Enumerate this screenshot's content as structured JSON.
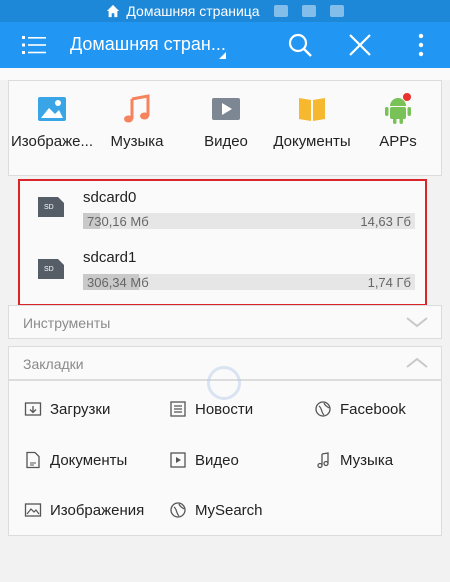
{
  "status_bar": {
    "title": "Домашняя страница"
  },
  "app_bar": {
    "title": "Домашняя стран..."
  },
  "categories": [
    {
      "label": "Изображе...",
      "icon": "image-icon"
    },
    {
      "label": "Музыка",
      "icon": "music-icon"
    },
    {
      "label": "Видео",
      "icon": "video-icon"
    },
    {
      "label": "Документы",
      "icon": "documents-icon"
    },
    {
      "label": "APPs",
      "icon": "android-icon"
    }
  ],
  "storage": [
    {
      "name": "sdcard0",
      "used": "730,16 Мб",
      "total": "14,63 Гб",
      "used_fraction": 0.05
    },
    {
      "name": "sdcard1",
      "used": "306,34 Мб",
      "total": "1,74 Гб",
      "used_fraction": 0.17
    }
  ],
  "tools": {
    "label": "Инструменты"
  },
  "bookmarks": {
    "label": "Закладки",
    "items": [
      {
        "label": "Загрузки",
        "icon": "download-folder-icon"
      },
      {
        "label": "Новости",
        "icon": "news-icon"
      },
      {
        "label": "Facebook",
        "icon": "globe-icon"
      },
      {
        "label": "Документы",
        "icon": "document-icon"
      },
      {
        "label": "Видео",
        "icon": "video-file-icon"
      },
      {
        "label": "Музыка",
        "icon": "music-note-icon"
      },
      {
        "label": "Изображения",
        "icon": "picture-icon"
      },
      {
        "label": "MySearch",
        "icon": "globe-icon"
      }
    ]
  },
  "colors": {
    "status_bar": "#1e88d8",
    "app_bar": "#2196f3",
    "highlight_border": "#d9252a"
  }
}
